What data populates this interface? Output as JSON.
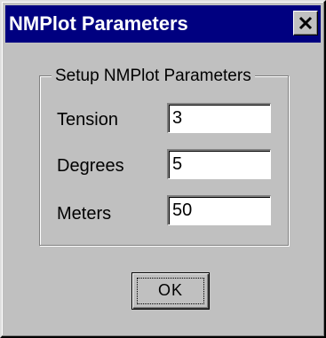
{
  "window": {
    "title": "NMPlot Parameters"
  },
  "group": {
    "label": "Setup NMPlot Parameters"
  },
  "fields": [
    {
      "label": "Tension",
      "value": "3"
    },
    {
      "label": "Degrees",
      "value": "5"
    },
    {
      "label": "Meters",
      "value": "50"
    }
  ],
  "buttons": {
    "ok_label": "OK"
  },
  "icons": {
    "close": "close-icon"
  },
  "colors": {
    "titlebar": "#000080",
    "face": "#c0c0c0"
  }
}
